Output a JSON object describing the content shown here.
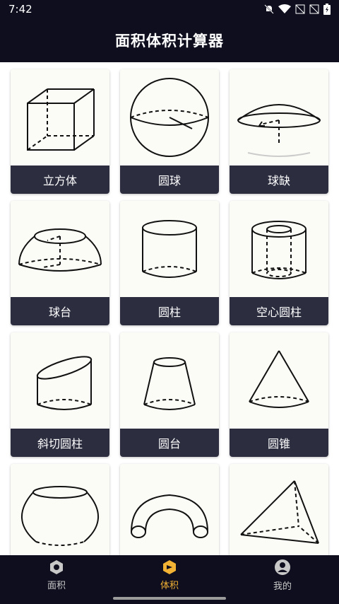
{
  "status_bar": {
    "time": "7:42"
  },
  "header": {
    "title": "面积体积计算器"
  },
  "shapes": [
    {
      "label": "立方体",
      "icon": "cube-icon"
    },
    {
      "label": "圆球",
      "icon": "sphere-icon"
    },
    {
      "label": "球缺",
      "icon": "spherical-cap-icon"
    },
    {
      "label": "球台",
      "icon": "spherical-frustum-icon"
    },
    {
      "label": "圆柱",
      "icon": "cylinder-icon"
    },
    {
      "label": "空心圆柱",
      "icon": "hollow-cylinder-icon"
    },
    {
      "label": "斜切圆柱",
      "icon": "oblique-cylinder-icon"
    },
    {
      "label": "圆台",
      "icon": "truncated-cone-icon"
    },
    {
      "label": "圆锥",
      "icon": "cone-icon"
    },
    {
      "label": "",
      "icon": "barrel-icon"
    },
    {
      "label": "",
      "icon": "torus-icon"
    },
    {
      "label": "",
      "icon": "tetrahedron-icon"
    }
  ],
  "tabs": [
    {
      "label": "面积",
      "icon": "hexagon-icon",
      "active": false
    },
    {
      "label": "体积",
      "icon": "box-icon",
      "active": true
    },
    {
      "label": "我的",
      "icon": "person-icon",
      "active": false
    }
  ],
  "colors": {
    "header_bg": "#0e0e1e",
    "card_label_bg": "#2c2e40",
    "tab_active": "#f2b233",
    "tab_inactive": "#c8c8c8"
  }
}
